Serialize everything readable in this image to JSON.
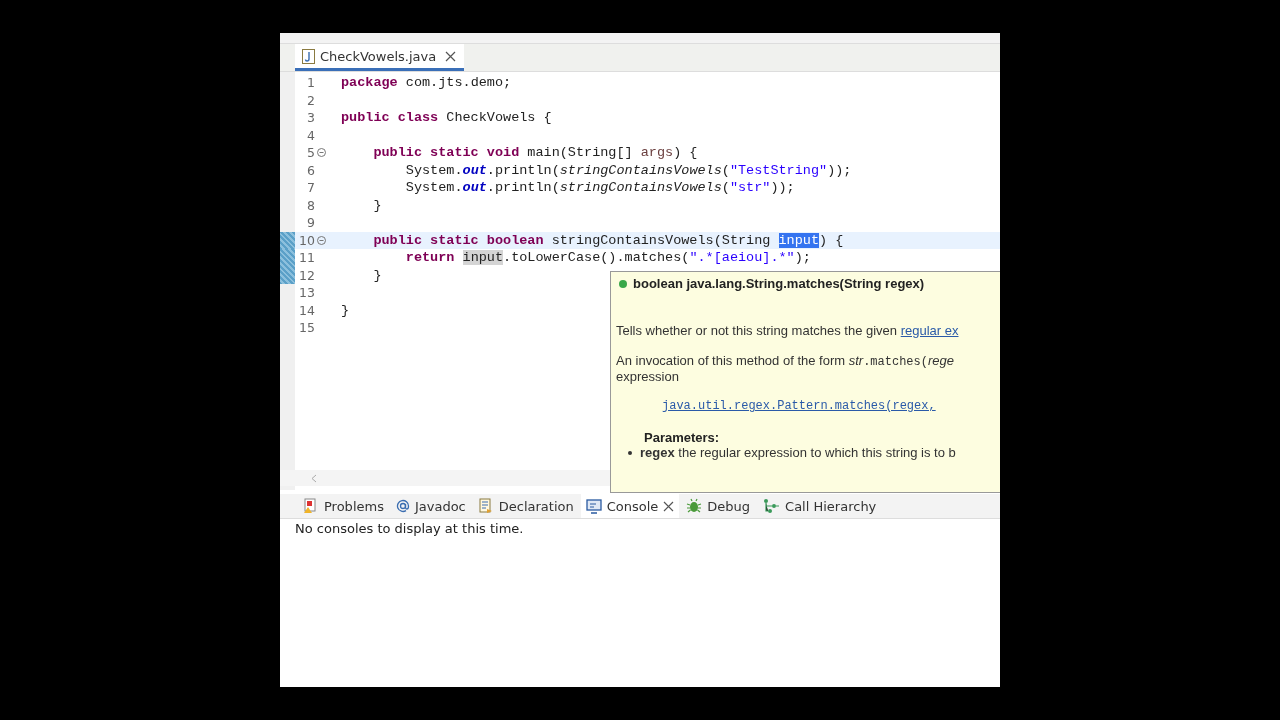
{
  "editor_tabs": [
    {
      "label": "CheckVowels.java",
      "selected": true
    }
  ],
  "code_lines": [
    {
      "number": "1",
      "foldable": false,
      "changed": false,
      "current": false,
      "tokens": [
        {
          "kind": "keyword",
          "text": "package"
        },
        {
          "kind": "plain",
          "text": " com.jts.demo;"
        }
      ]
    },
    {
      "number": "2",
      "foldable": false,
      "changed": false,
      "current": false
    },
    {
      "number": "3",
      "foldable": false,
      "changed": false,
      "current": false,
      "tokens": [
        {
          "kind": "keyword",
          "text": "public class"
        },
        {
          "kind": "plain",
          "text": " CheckVowels {"
        }
      ]
    },
    {
      "number": "4",
      "foldable": false,
      "changed": false,
      "current": false
    },
    {
      "number": "5",
      "foldable": true,
      "changed": false,
      "current": false,
      "tokens": [
        {
          "kind": "keyword",
          "text": "    public static void"
        },
        {
          "kind": "plain",
          "text": " main(String[] "
        },
        {
          "kind": "param",
          "text": "args"
        },
        {
          "kind": "plain",
          "text": ") {"
        }
      ]
    },
    {
      "number": "6",
      "foldable": false,
      "changed": false,
      "current": false,
      "tokens": [
        {
          "kind": "plain",
          "text": "        System."
        },
        {
          "kind": "field",
          "text": "out"
        },
        {
          "kind": "plain",
          "text": ".println("
        },
        {
          "kind": "static",
          "text": "stringContainsVowels"
        },
        {
          "kind": "plain",
          "text": "("
        },
        {
          "kind": "string",
          "text": "\"TestString\""
        },
        {
          "kind": "plain",
          "text": "));"
        }
      ]
    },
    {
      "number": "7",
      "foldable": false,
      "changed": false,
      "current": false,
      "tokens": [
        {
          "kind": "plain",
          "text": "        System."
        },
        {
          "kind": "field",
          "text": "out"
        },
        {
          "kind": "plain",
          "text": ".println("
        },
        {
          "kind": "static",
          "text": "stringContainsVowels"
        },
        {
          "kind": "plain",
          "text": "("
        },
        {
          "kind": "string",
          "text": "\"str\""
        },
        {
          "kind": "plain",
          "text": "));"
        }
      ]
    },
    {
      "number": "8",
      "foldable": false,
      "changed": false,
      "current": false,
      "tokens": [
        {
          "kind": "plain",
          "text": "    }"
        }
      ]
    },
    {
      "number": "9",
      "foldable": false,
      "changed": false,
      "current": false
    },
    {
      "number": "10",
      "foldable": true,
      "changed": true,
      "current": true,
      "tokens": [
        {
          "kind": "keyword",
          "text": "    public static boolean"
        },
        {
          "kind": "plain",
          "text": " stringContainsVowels(String "
        },
        {
          "kind": "selection",
          "text": "input"
        },
        {
          "kind": "plain",
          "text": ") {"
        }
      ]
    },
    {
      "number": "11",
      "foldable": false,
      "changed": true,
      "current": false,
      "tokens": [
        {
          "kind": "keyword",
          "text": "        return "
        },
        {
          "kind": "occurrence",
          "text": "input"
        },
        {
          "kind": "plain",
          "text": ".toLowerCase().matches("
        },
        {
          "kind": "string",
          "text": "\".*[aeiou].*\""
        },
        {
          "kind": "plain",
          "text": ");"
        }
      ]
    },
    {
      "number": "12",
      "foldable": false,
      "changed": true,
      "current": false,
      "tokens": [
        {
          "kind": "plain",
          "text": "    }"
        }
      ]
    },
    {
      "number": "13",
      "foldable": false,
      "changed": false,
      "current": false
    },
    {
      "number": "14",
      "foldable": false,
      "changed": false,
      "current": false,
      "tokens": [
        {
          "kind": "plain",
          "text": "}"
        }
      ]
    },
    {
      "number": "15",
      "foldable": false,
      "changed": false,
      "current": false
    }
  ],
  "hover": {
    "signature": "boolean java.lang.String.matches(String regex)",
    "description": [
      {
        "kind": "text",
        "text": "Tells whether or not this string matches the given "
      },
      {
        "kind": "link",
        "text": "regular ex"
      }
    ],
    "invocation": [
      {
        "kind": "text",
        "text": "An invocation of this method of the form "
      },
      {
        "kind": "italic",
        "text": "str"
      },
      {
        "kind": "code",
        "text": ".matches("
      },
      {
        "kind": "italic",
        "text": "rege"
      }
    ],
    "invocation_cont": "expression",
    "code_sample": "java.util.regex.Pattern.matches(regex,",
    "params_heading": "Parameters:",
    "params": [
      {
        "name": "regex",
        "text": "the regular expression to which this string is to b"
      }
    ]
  },
  "panel_tabs": [
    {
      "kind": "problems",
      "label": "Problems",
      "selected": false,
      "closable": false
    },
    {
      "kind": "javadoc",
      "label": "Javadoc",
      "selected": false,
      "closable": false
    },
    {
      "kind": "declaration",
      "label": "Declaration",
      "selected": false,
      "closable": false
    },
    {
      "kind": "console",
      "label": "Console",
      "selected": true,
      "closable": true
    },
    {
      "kind": "debug",
      "label": "Debug",
      "selected": false,
      "closable": false
    },
    {
      "kind": "hierarchy",
      "label": "Call Hierarchy",
      "selected": false,
      "closable": false
    }
  ],
  "console_message": "No consoles to display at this time."
}
